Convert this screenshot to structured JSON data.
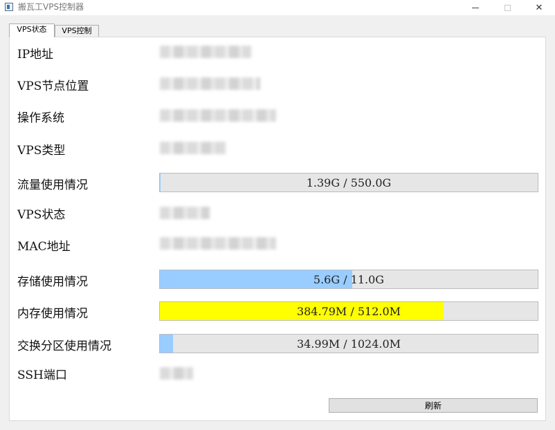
{
  "window": {
    "title": "搬瓦工VPS控制器",
    "close_glyph": "✕"
  },
  "tabs": [
    {
      "label": "VPS状态",
      "active": true
    },
    {
      "label": "VPS控制",
      "active": false
    }
  ],
  "fields": {
    "ip": {
      "label": "IP地址"
    },
    "location": {
      "label": "VPS节点位置"
    },
    "os": {
      "label": "操作系统"
    },
    "type": {
      "label": "VPS类型"
    },
    "traffic": {
      "label": "流量使用情况",
      "text": "1.39G / 550.0G",
      "fraction": 0.0025,
      "color": "#99ccff"
    },
    "status": {
      "label": "VPS状态"
    },
    "mac": {
      "label": "MAC地址"
    },
    "storage": {
      "label": "存储使用情况",
      "text": "5.6G / 11.0G",
      "fraction": 0.5091,
      "color": "#99ccff"
    },
    "memory": {
      "label": "内存使用情况",
      "text": "384.79M / 512.0M",
      "fraction": 0.7515,
      "color": "#ffff00"
    },
    "swap": {
      "label": "交换分区使用情况",
      "text": "34.99M / 1024.0M",
      "fraction": 0.0342,
      "color": "#99ccff"
    },
    "ssh": {
      "label": "SSH端口"
    }
  },
  "buttons": {
    "refresh": "刷新"
  }
}
